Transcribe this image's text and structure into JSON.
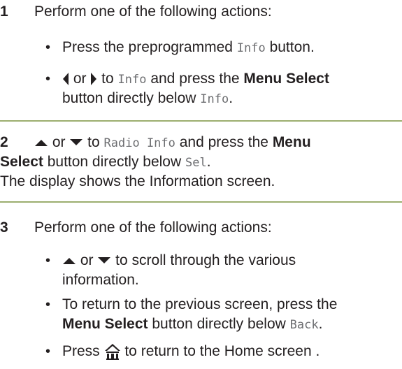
{
  "step1": {
    "number": "1",
    "intro": "Perform one of the following actions:",
    "bullet1": {
      "pre": "Press the preprogrammed ",
      "code": "Info",
      "post": " button."
    },
    "bullet2": {
      "or": " or ",
      "to": " to ",
      "code1": "Info",
      "mid": " and press the ",
      "bold": "Menu Select",
      "line2_pre": "button directly below ",
      "code2": "Info",
      "line2_post": "."
    }
  },
  "step2": {
    "number": "2",
    "or": " or ",
    "to": " to ",
    "code1": "Radio Info",
    "mid": " and press the ",
    "bold1": "Menu",
    "bold2": "Select",
    "line2_mid": " button directly below ",
    "code2": "Sel",
    "line2_post": ".",
    "line3": "The display shows the Information screen."
  },
  "step3": {
    "number": "3",
    "intro": "Perform one of the following actions:",
    "bullet1": {
      "or": " or ",
      "rest": " to scroll through the various",
      "line2": "information."
    },
    "bullet2": {
      "line1": "To return to the previous screen, press the",
      "bold": "Menu Select",
      "mid": " button directly below ",
      "code": "Back",
      "post": "."
    },
    "bullet3": {
      "pre": "Press ",
      "post": " to return to the Home screen ."
    }
  },
  "bullet_char": "•",
  "icons": [
    "left-arrow-icon",
    "right-arrow-icon",
    "up-arrow-icon",
    "down-arrow-icon",
    "home-icon"
  ],
  "colors": {
    "text": "#231f20",
    "code": "#6d6e71",
    "rule": "#9cae6f"
  }
}
